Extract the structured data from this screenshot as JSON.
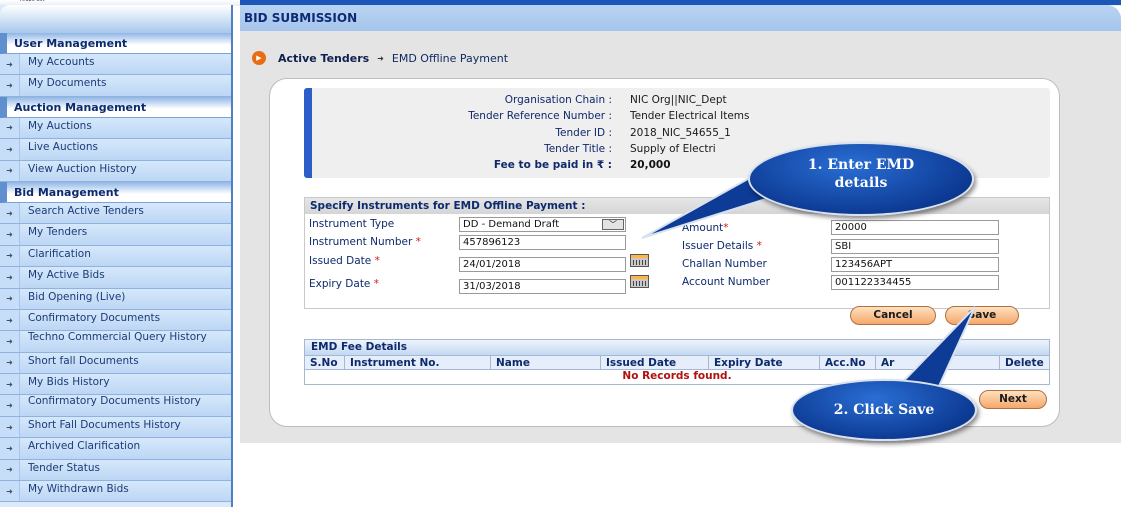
{
  "top": {
    "mini_text": "Arabe Skt"
  },
  "sidebar": {
    "sections": [
      {
        "title": "User Management",
        "items": [
          "My Accounts",
          "My Documents"
        ]
      },
      {
        "title": "Auction Management",
        "items": [
          "My Auctions",
          "Live Auctions",
          "View Auction History"
        ]
      },
      {
        "title": "Bid Management",
        "items": [
          "Search Active Tenders",
          "My Tenders",
          "Clarification",
          "My Active Bids",
          "Bid Opening (Live)",
          "Confirmatory Documents",
          "Techno Commercial Query History",
          "Short fall Documents",
          "My Bids History",
          "Confirmatory Documents History",
          "Short Fall Documents History",
          "Archived Clarification",
          "Tender Status",
          "My Withdrawn Bids"
        ]
      }
    ]
  },
  "main": {
    "title": "BID SUBMISSION",
    "breadcrumb": {
      "first": "Active Tenders",
      "second": "EMD Offline Payment"
    }
  },
  "tender_info": {
    "rows": [
      {
        "key": "Organisation Chain :",
        "value": "NIC Org||NIC_Dept"
      },
      {
        "key": "Tender Reference Number :",
        "value": "Tender Electrical Items"
      },
      {
        "key": "Tender ID :",
        "value": "2018_NIC_54655_1"
      },
      {
        "key": "Tender Title :",
        "value": "Supply of Electri"
      },
      {
        "key": "Fee to be paid in ₹ :",
        "value": "20,000"
      }
    ]
  },
  "form": {
    "title": "Specify Instruments for EMD Offline Payment :",
    "instrument_type": {
      "label": "Instrument Type",
      "value": "DD - Demand Draft"
    },
    "instrument_number": {
      "label": "Instrument Number",
      "value": "457896123"
    },
    "issued_date": {
      "label": "Issued Date",
      "value": "24/01/2018"
    },
    "expiry_date": {
      "label": "Expiry Date",
      "value": "31/03/2018"
    },
    "amount": {
      "label": "Amount",
      "value": "20000"
    },
    "issuer_details": {
      "label": "Issuer Details",
      "value": "SBI"
    },
    "challan_number": {
      "label": "Challan Number",
      "value": "123456APT"
    },
    "account_number": {
      "label": "Account Number",
      "value": "001122334455"
    },
    "required_mark": "*",
    "cancel_label": "Cancel",
    "save_label": "Save"
  },
  "fee_details": {
    "title": "EMD Fee Details",
    "columns": [
      "S.No",
      "Instrument No.",
      "Name",
      "Issued Date",
      "Expiry Date",
      "Acc.No",
      "Ar",
      "Delete"
    ],
    "empty_message": "No Records found."
  },
  "next_label": "Next",
  "callouts": {
    "first": "1. Enter  EMD details",
    "second": "2. Click  Save"
  },
  "colors": {
    "header_text": "#0d2a75",
    "accent_orange": "#e86c12",
    "button_orange": "#f6a76a",
    "callout_blue": "#0d3b95",
    "error_red": "#b01010"
  }
}
